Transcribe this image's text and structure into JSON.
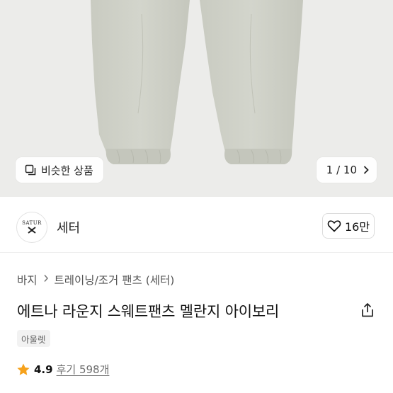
{
  "hero": {
    "similar_label": "비슷한 상품",
    "counter_label": "1 / 10"
  },
  "brand": {
    "logo_text": "SATUR",
    "name": "세터",
    "likes": "16만"
  },
  "breadcrumb": {
    "items": [
      "바지",
      "트레이닝/조거 팬츠 (세터)"
    ]
  },
  "product": {
    "title": "에트나 라운지 스웨트팬츠 멜란지 아이보리",
    "tag": "아울렛",
    "rating": "4.9",
    "reviews": "후기 598개"
  },
  "colors": {
    "star": "#f6a21c",
    "hero_bg": "#ececea",
    "pants": "#cdcfc6"
  }
}
